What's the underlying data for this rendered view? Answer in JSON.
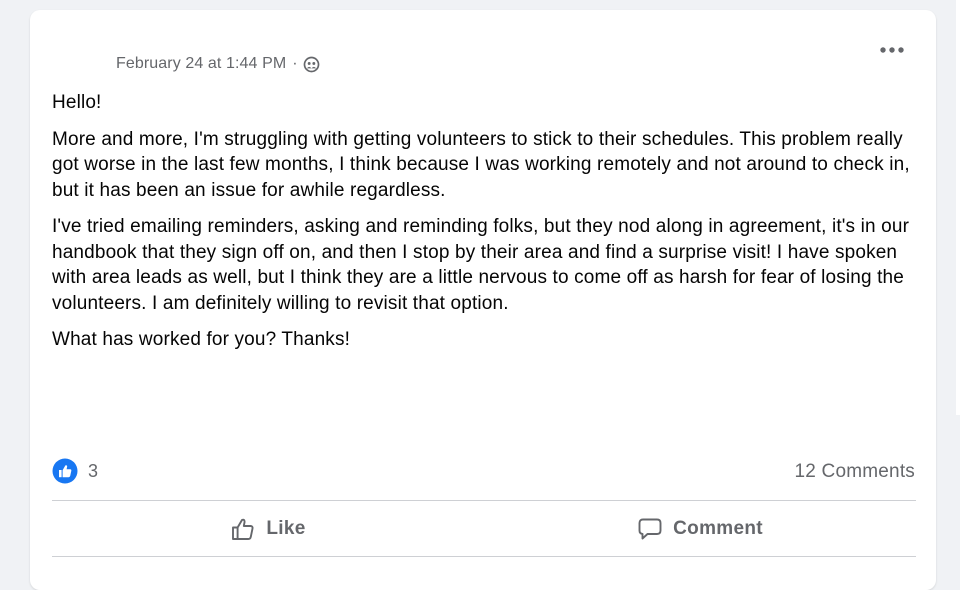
{
  "post": {
    "timestamp": "February 24 at 1:44 PM",
    "separator": "·",
    "audience_icon": "group-privacy-icon",
    "more_icon": "more-horizontal-icon",
    "paragraphs": [
      "Hello!",
      "More and more, I'm struggling with getting volunteers to stick to their schedules. This problem really got worse in the last few months, I think because I was working remotely and not around to check in, but it has been an issue for awhile regardless.",
      "I've tried emailing reminders, asking and reminding folks, but they nod along in agreement, it's in our handbook that they sign off on, and then I stop by their area and find a surprise visit! I have spoken with area leads as well, but I think they are a little nervous to come off as harsh for fear of losing the volunteers. I am definitely willing to revisit that option.",
      "What has worked for you? Thanks!"
    ]
  },
  "stats": {
    "reaction_icon": "like-reaction-icon",
    "reaction_count": "3",
    "comments_label": "12 Comments"
  },
  "actions": {
    "like_label": "Like",
    "comment_label": "Comment"
  },
  "colors": {
    "secondary_text": "#65676b",
    "primary_text": "#050505",
    "like_blue": "#1877f2",
    "divider": "#ced0d4",
    "background": "#f0f2f5"
  }
}
